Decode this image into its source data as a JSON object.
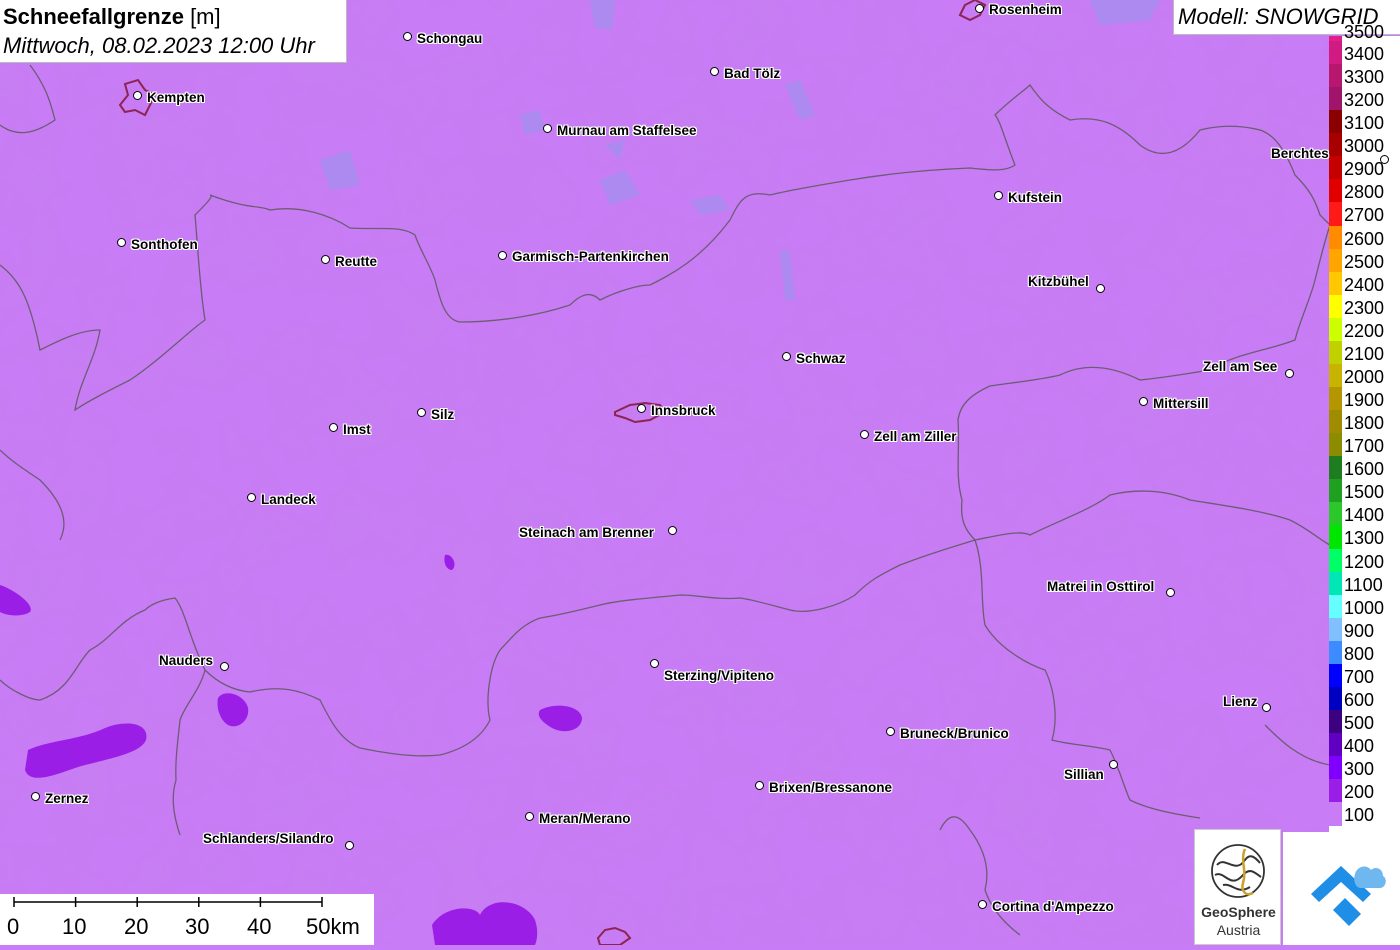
{
  "title": {
    "param_name": "Schneefallgrenze",
    "unit": " [m]",
    "datetime": "Mittwoch, 08.02.2023 12:00 Uhr"
  },
  "model_label": "Modell: SNOWGRID",
  "legend": {
    "top_cutoff": "3500",
    "items": [
      {
        "label": "3400",
        "color": "#d11a82"
      },
      {
        "label": "3300",
        "color": "#b8176f"
      },
      {
        "label": "3200",
        "color": "#a0146a"
      },
      {
        "label": "3100",
        "color": "#8b0000"
      },
      {
        "label": "3000",
        "color": "#a80000"
      },
      {
        "label": "2900",
        "color": "#c40000"
      },
      {
        "label": "2800",
        "color": "#e00000"
      },
      {
        "label": "2700",
        "color": "#ff1a1a"
      },
      {
        "label": "2600",
        "color": "#ff8c00"
      },
      {
        "label": "2500",
        "color": "#ffa500"
      },
      {
        "label": "2400",
        "color": "#ffc800"
      },
      {
        "label": "2300",
        "color": "#ffff00"
      },
      {
        "label": "2200",
        "color": "#ccff00"
      },
      {
        "label": "2100",
        "color": "#c0d000"
      },
      {
        "label": "2000",
        "color": "#c8b400"
      },
      {
        "label": "1900",
        "color": "#b49600"
      },
      {
        "label": "1800",
        "color": "#a08c00"
      },
      {
        "label": "1700",
        "color": "#8c8c00"
      },
      {
        "label": "1600",
        "color": "#1e7d1e"
      },
      {
        "label": "1500",
        "color": "#20a020"
      },
      {
        "label": "1400",
        "color": "#2bc82b"
      },
      {
        "label": "1300",
        "color": "#00e600"
      },
      {
        "label": "1200",
        "color": "#00ff66"
      },
      {
        "label": "1100",
        "color": "#00e6b4"
      },
      {
        "label": "1000",
        "color": "#66ffff"
      },
      {
        "label": "900",
        "color": "#80c0ff"
      },
      {
        "label": "800",
        "color": "#3c8cff"
      },
      {
        "label": "700",
        "color": "#0000ff"
      },
      {
        "label": "600",
        "color": "#0000c0"
      },
      {
        "label": "500",
        "color": "#3c0080"
      },
      {
        "label": "400",
        "color": "#6000c0"
      },
      {
        "label": "300",
        "color": "#8000ff"
      },
      {
        "label": "200",
        "color": "#9a1ee6"
      },
      {
        "label": "100",
        "color": "#c87cf5"
      }
    ]
  },
  "cities": [
    {
      "name": "Rosenheim"
    },
    {
      "name": "Schongau"
    },
    {
      "name": "Bad Tölz"
    },
    {
      "name": "Kempten"
    },
    {
      "name": "Murnau am Staffelsee"
    },
    {
      "name": "Berchtes"
    },
    {
      "name": "Kufstein"
    },
    {
      "name": "Sonthofen"
    },
    {
      "name": "Reutte"
    },
    {
      "name": "Garmisch-Partenkirchen"
    },
    {
      "name": "Kitzbühel"
    },
    {
      "name": "Schwaz"
    },
    {
      "name": "Zell am See"
    },
    {
      "name": "Mittersill"
    },
    {
      "name": "Silz"
    },
    {
      "name": "Innsbruck"
    },
    {
      "name": "Imst"
    },
    {
      "name": "Zell am Ziller"
    },
    {
      "name": "Landeck"
    },
    {
      "name": "Steinach am Brenner"
    },
    {
      "name": "Matrei in Osttirol"
    },
    {
      "name": "Nauders"
    },
    {
      "name": "Sterzing/Vipiteno"
    },
    {
      "name": "Lienz"
    },
    {
      "name": "Bruneck/Brunico"
    },
    {
      "name": "Sillian"
    },
    {
      "name": "Zernez"
    },
    {
      "name": "Brixen/Bressanone"
    },
    {
      "name": "Meran/Merano"
    },
    {
      "name": "Schlanders/Silandro"
    },
    {
      "name": "Cortina d'Ampezzo"
    }
  ],
  "scale_bar": {
    "labels": [
      "0",
      "10",
      "20",
      "30",
      "40",
      "50km"
    ]
  },
  "logos": {
    "geosphere_line1": "GeoSphere",
    "geosphere_line2": "Austria"
  }
}
